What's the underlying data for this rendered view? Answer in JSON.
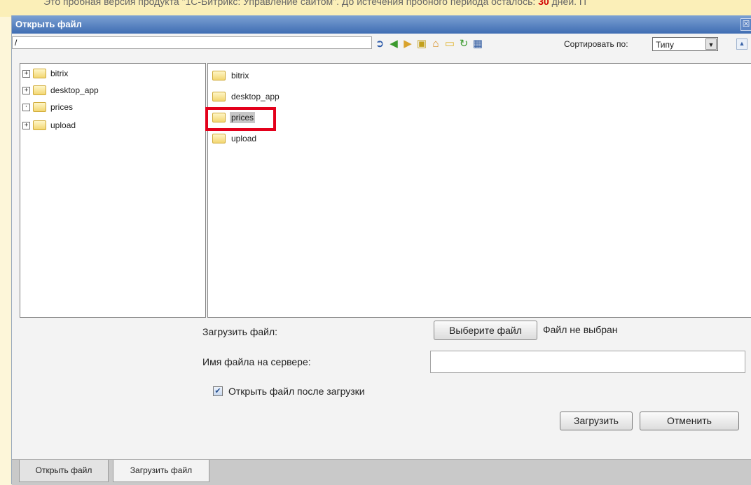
{
  "background": {
    "notice_text": "Это пробная версия продукта \"1С-Битрикс: Управление сайтом\". До истечения пробного периода осталось:",
    "notice_days": "30",
    "notice_tail": "дней. П"
  },
  "dialog": {
    "title": "Открыть файл",
    "close_symbol": "☒"
  },
  "pathbar": {
    "value": "/"
  },
  "toolbar": {
    "icons": [
      "go-icon",
      "back-icon",
      "forward-icon",
      "up-folder-icon",
      "home-icon",
      "new-folder-icon",
      "refresh-icon",
      "view-mode-icon"
    ]
  },
  "sort": {
    "label": "Сортировать по:",
    "value": "Типу",
    "direction_symbol": "▲"
  },
  "tree": {
    "items": [
      {
        "expander": "+",
        "label": "bitrix"
      },
      {
        "expander": "+",
        "label": "desktop_app"
      },
      {
        "expander": "·",
        "label": "prices"
      },
      {
        "expander": "+",
        "label": "upload"
      }
    ]
  },
  "files": {
    "items": [
      {
        "label": "bitrix",
        "selected": false
      },
      {
        "label": "desktop_app",
        "selected": false
      },
      {
        "label": "prices",
        "selected": true
      },
      {
        "label": "upload",
        "selected": false
      }
    ]
  },
  "upload": {
    "upload_label": "Загрузить файл:",
    "choose_button": "Выберите файл",
    "no_file": "Файл не выбран",
    "server_name_label": "Имя файла на сервере:",
    "server_name_value": "",
    "open_after_label": "Открыть файл после загрузки",
    "open_after_checked": true,
    "upload_button": "Загрузить",
    "cancel_button": "Отменить"
  },
  "tabs": [
    {
      "label": "Открыть файл",
      "active": false
    },
    {
      "label": "Загрузить файл",
      "active": true
    }
  ]
}
